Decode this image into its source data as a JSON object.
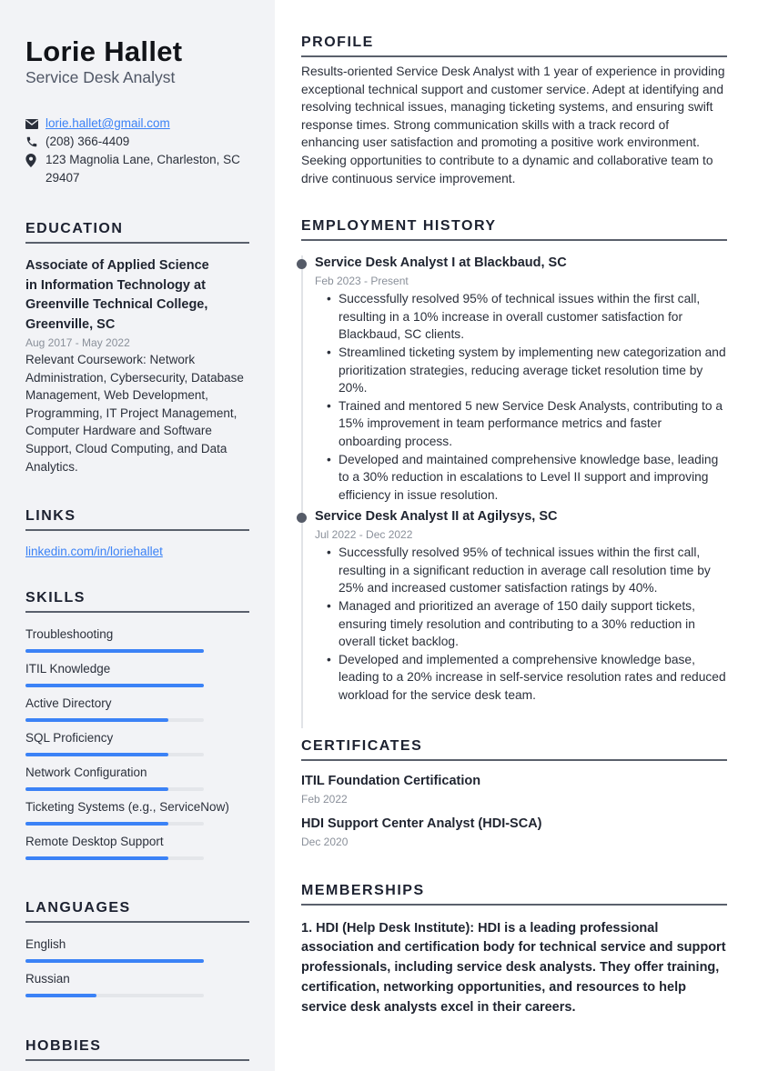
{
  "header": {
    "name": "Lorie Hallet",
    "role": "Service Desk Analyst"
  },
  "contacts": {
    "email": "lorie.hallet@gmail.com",
    "phone": "(208) 366-4409",
    "address": "123 Magnolia Lane, Charleston, SC 29407",
    "icons": [
      "envelope-icon",
      "phone-icon",
      "map-pin-icon"
    ]
  },
  "education": {
    "title": "EDUCATION",
    "items": [
      {
        "degree": "Associate of Applied Science in Information Technology at Greenville Technical College, Greenville, SC",
        "date": "Aug 2017 - May 2022",
        "description": "Relevant Coursework: Network Administration, Cybersecurity, Database Management, Web Development, Programming, IT Project Management, Computer Hardware and Software Support, Cloud Computing, and Data Analytics."
      }
    ]
  },
  "links": {
    "title": "LINKS",
    "items": [
      {
        "label": "linkedin.com/in/loriehallet"
      }
    ]
  },
  "skills": {
    "title": "SKILLS",
    "items": [
      {
        "name": "Troubleshooting",
        "level": 1.0
      },
      {
        "name": "ITIL Knowledge",
        "level": 1.0
      },
      {
        "name": "Active Directory",
        "level": 0.8
      },
      {
        "name": "SQL Proficiency",
        "level": 0.8
      },
      {
        "name": "Network Configuration",
        "level": 0.8
      },
      {
        "name": "Ticketing Systems (e.g., ServiceNow)",
        "level": 0.8
      },
      {
        "name": "Remote Desktop Support",
        "level": 0.8
      }
    ]
  },
  "languages": {
    "title": "LANGUAGES",
    "items": [
      {
        "name": "English",
        "level": 1.0
      },
      {
        "name": "Russian",
        "level": 0.4
      }
    ]
  },
  "hobbies": {
    "title": "HOBBIES"
  },
  "profile": {
    "title": "PROFILE",
    "text": "Results-oriented Service Desk Analyst with 1 year of experience in providing exceptional technical support and customer service. Adept at identifying and resolving technical issues, managing ticketing systems, and ensuring swift response times. Strong communication skills with a track record of enhancing user satisfaction and promoting a positive work environment. Seeking opportunities to contribute to a dynamic and collaborative team to drive continuous service improvement."
  },
  "employment": {
    "title": "EMPLOYMENT HISTORY",
    "jobs": [
      {
        "title": "Service Desk Analyst I at Blackbaud, SC",
        "date": "Feb 2023 - Present",
        "bullets": [
          "Successfully resolved 95% of technical issues within the first call, resulting in a 10% increase in overall customer satisfaction for Blackbaud, SC clients.",
          "Streamlined ticketing system by implementing new categorization and prioritization strategies, reducing average ticket resolution time by 20%.",
          "Trained and mentored 5 new Service Desk Analysts, contributing to a 15% improvement in team performance metrics and faster onboarding process.",
          "Developed and maintained comprehensive knowledge base, leading to a 30% reduction in escalations to Level II support and improving efficiency in issue resolution."
        ]
      },
      {
        "title": "Service Desk Analyst II at Agilysys, SC",
        "date": "Jul 2022 - Dec 2022",
        "bullets": [
          "Successfully resolved 95% of technical issues within the first call, resulting in a significant reduction in average call resolution time by 25% and increased customer satisfaction ratings by 40%.",
          "Managed and prioritized an average of 150 daily support tickets, ensuring timely resolution and contributing to a 30% reduction in overall ticket backlog.",
          "Developed and implemented a comprehensive knowledge base, leading to a 20% increase in self-service resolution rates and reduced workload for the service desk team."
        ]
      }
    ]
  },
  "certificates": {
    "title": "CERTIFICATES",
    "items": [
      {
        "name": "ITIL Foundation Certification",
        "date": "Feb 2022"
      },
      {
        "name": "HDI Support Center Analyst (HDI-SCA)",
        "date": "Dec 2020"
      }
    ]
  },
  "memberships": {
    "title": "MEMBERSHIPS",
    "text": "1. HDI (Help Desk Institute): HDI is a leading professional association and certification body for technical service and support professionals, including service desk analysts. They offer training, certification, networking opportunities, and resources to help service desk analysts excel in their careers."
  },
  "colors": {
    "accent": "#3b82f6",
    "sidebar_bg": "#f2f3f6",
    "heading": "#1c2130",
    "muted": "#8a909a",
    "bar_track": "#e4e6ea"
  }
}
